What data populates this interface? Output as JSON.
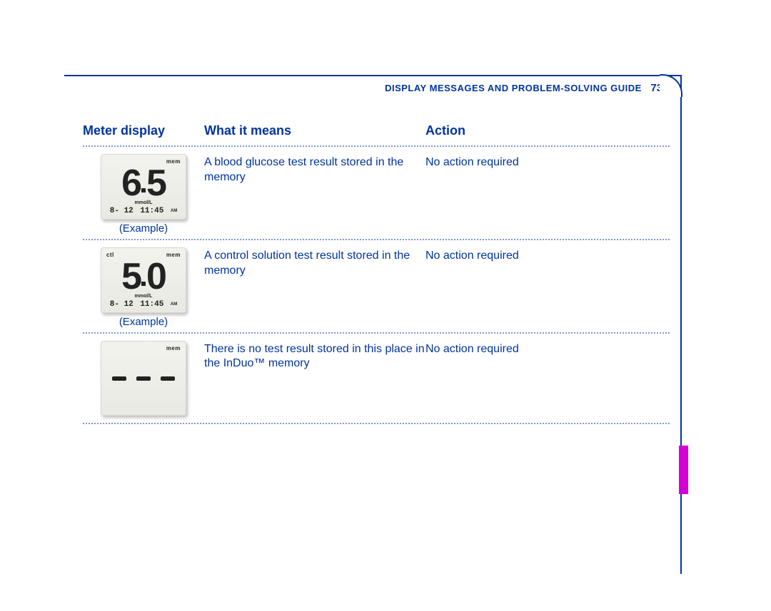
{
  "header": {
    "title": "DISPLAY MESSAGES AND PROBLEM-SOLVING GUIDE",
    "page_number": "73"
  },
  "columns": {
    "display": "Meter display",
    "meaning": "What it means",
    "action": "Action"
  },
  "rows": [
    {
      "lcd": {
        "ctl": "",
        "mem": "mem",
        "value": "6.5",
        "unit": "mmol/L",
        "date": "8- 12",
        "time": "11:45",
        "ampm": "AM"
      },
      "caption": "(Example)",
      "meaning": "A blood glucose test result stored in the memory",
      "action": "No action required"
    },
    {
      "lcd": {
        "ctl": "ctl",
        "mem": "mem",
        "value": "5.0",
        "unit": "mmol/L",
        "date": "8- 12",
        "time": "11:45",
        "ampm": "AM"
      },
      "caption": "(Example)",
      "meaning": "A control solution test result stored in the memory",
      "action": "No action required"
    },
    {
      "lcd": {
        "ctl": "",
        "mem": "mem",
        "value": "---",
        "unit": "",
        "date": "",
        "time": "",
        "ampm": ""
      },
      "caption": "",
      "meaning": "There is no test result stored in this place in the InDuo™ memory",
      "action": "No action required"
    }
  ],
  "colors": {
    "brand_blue": "#0033a0",
    "tab_magenta": "#d400d4",
    "lcd_bg": "#eeeee8"
  }
}
